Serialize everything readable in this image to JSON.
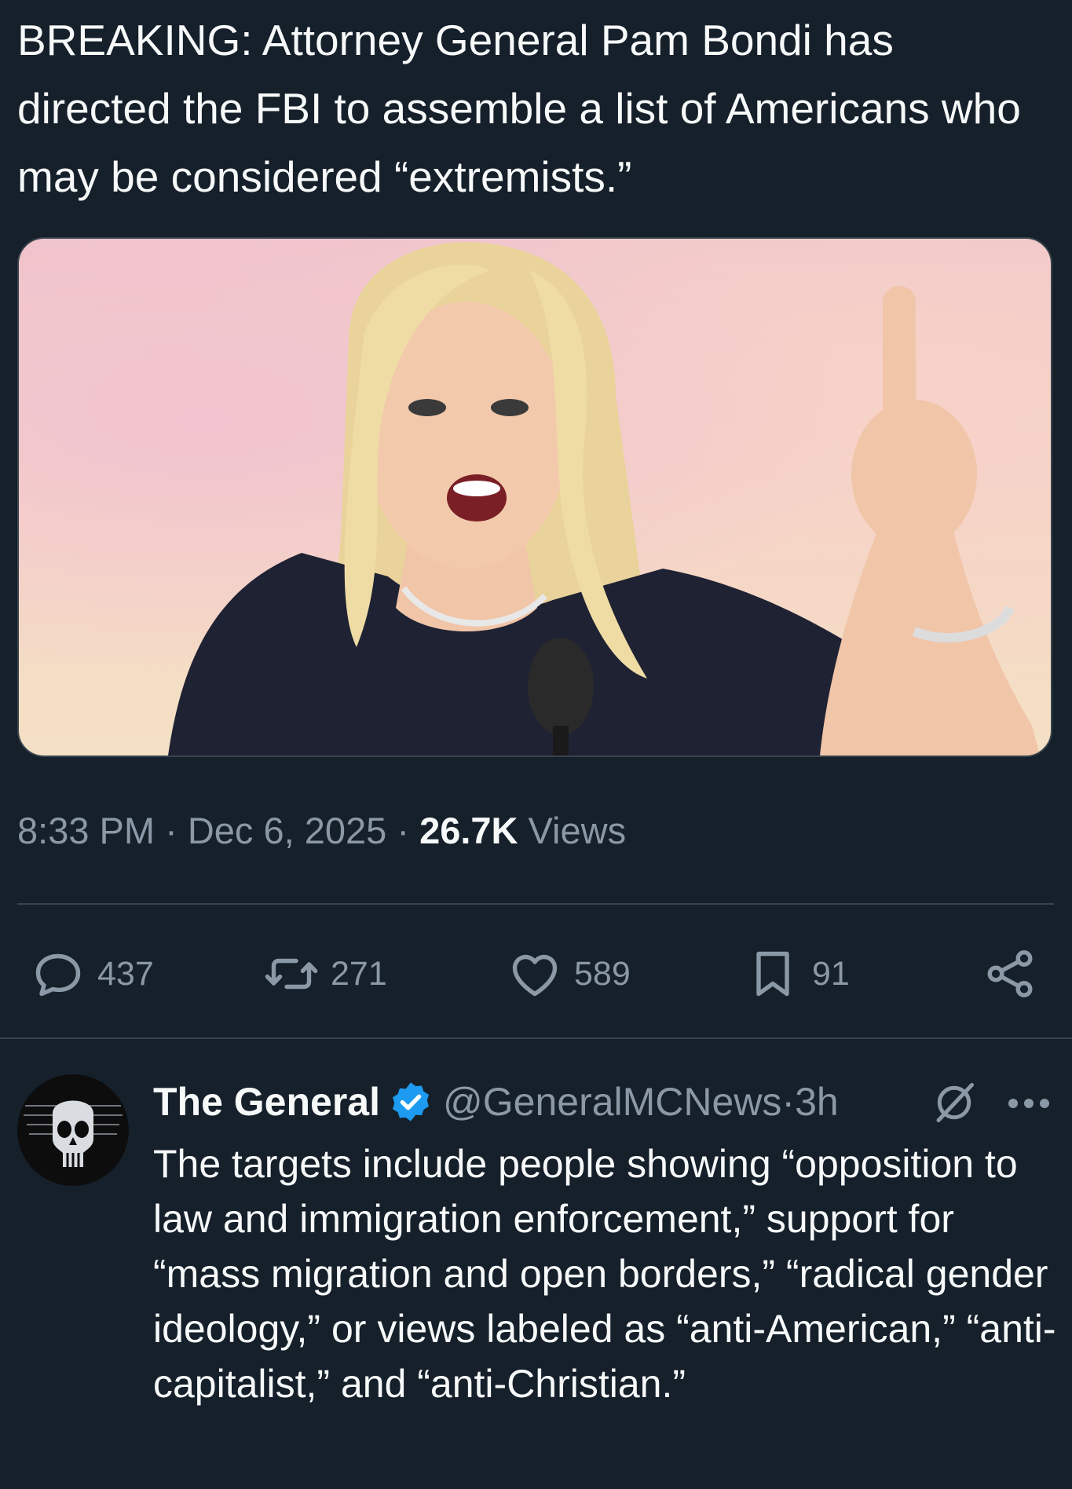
{
  "tweet": {
    "text": "BREAKING: Attorney General Pam Bondi has directed the FBI to assemble a list of Americans who may be considered “extremists.”",
    "time": "8:33 PM",
    "separator": " · ",
    "date": "Dec 6, 2025",
    "views_count": "26.7K",
    "views_label": " Views"
  },
  "actions": {
    "replies": "437",
    "reposts": "271",
    "likes": "589",
    "bookmarks": "91"
  },
  "reply": {
    "name": "The General",
    "handle": "@GeneralMCNews",
    "time_sep": " · ",
    "time": "3h",
    "text": "The targets include people showing “opposition to law and immigration enforcement,” support for “mass migration and open borders,” “radical gender ideology,” or views labeled as “anti-American,” “anti-capitalist,” and “anti-Christian.”"
  },
  "colors": {
    "background": "#15202b",
    "text": "#f7f9f9",
    "muted": "#8b98a5",
    "divider": "#38444d",
    "verified": "#1d9bf0"
  },
  "icons": [
    "reply-icon",
    "repost-icon",
    "like-icon",
    "bookmark-icon",
    "share-icon",
    "verified-badge-icon",
    "grok-icon",
    "more-icon"
  ]
}
